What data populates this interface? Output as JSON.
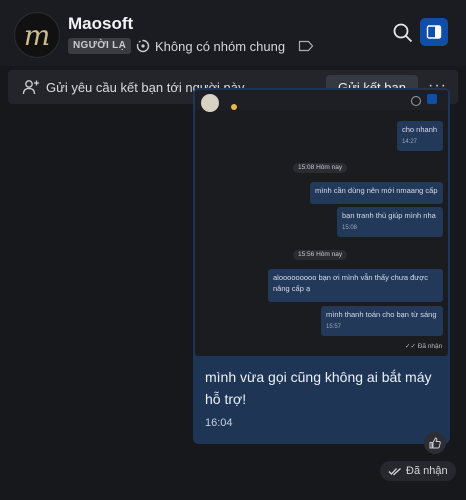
{
  "header": {
    "avatar_letter": "m",
    "name": "Maosoft",
    "badge": "NGƯỜI LẠ",
    "group_info": "Không có nhóm chung"
  },
  "friend_request": {
    "text": "Gửi yêu cầu kết bạn tới người này",
    "button": "Gửi kết bạn",
    "more": "···"
  },
  "screenshot_messages": [
    {
      "text": "cho nhanh",
      "time": "14:27"
    },
    {
      "divider": "15:08 Hôm nay"
    },
    {
      "text": "mình cần dùng nên mới nmaang cấp"
    },
    {
      "text": "bạn tranh thủ giúp mình nha",
      "time": "15:08"
    },
    {
      "divider": "15:56 Hôm nay"
    },
    {
      "text": "alooooooooo bạn ơi mình vẫn thấy chưa được nâng cấp ạ"
    },
    {
      "text": "mình thanh toán cho bạn từ sáng",
      "time": "15:57"
    },
    {
      "status": "Đã nhận"
    }
  ],
  "message": {
    "text": "mình vừa gọi cũng không ai bắt máy hỗ trợ!",
    "time": "16:04"
  },
  "status": "Đã nhận",
  "colors": {
    "background": "#17181c",
    "bubble": "#1e3556",
    "accent": "#0f4fa8"
  }
}
